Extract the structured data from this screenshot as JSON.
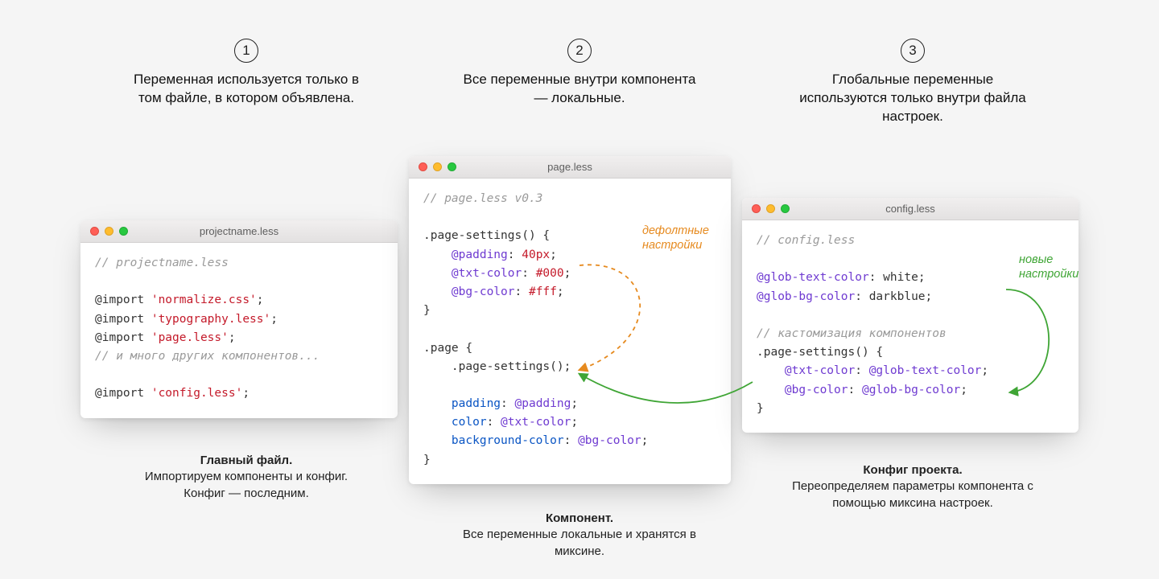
{
  "steps": [
    {
      "num": "1",
      "text": "Переменная используется только в том файле, в котором объявлена."
    },
    {
      "num": "2",
      "text": "Все переменные внутри компонента — локальные."
    },
    {
      "num": "3",
      "text": "Глобальные переменные используются только внутри файла настроек."
    }
  ],
  "windows": {
    "project": {
      "title": "projectname.less",
      "code": {
        "comment1": "// projectname.less",
        "imp": "@import",
        "s1": "'normalize.css'",
        "s2": "'typography.less'",
        "s3": "'page.less'",
        "comment2": "// и много других компонентов...",
        "s4": "'config.less'"
      }
    },
    "page": {
      "title": "page.less",
      "code": {
        "comment1": "// page.less v0.3",
        "sel_settings": ".page-settings()",
        "var_padding": "@padding",
        "val_padding": "40px",
        "var_txt": "@txt-color",
        "val_txt": "#000",
        "var_bg": "@bg-color",
        "val_bg": "#fff",
        "sel_page": ".page",
        "call_settings": ".page-settings()",
        "prop_padding": "padding",
        "prop_color": "color",
        "prop_bgcolor": "background-color"
      }
    },
    "config": {
      "title": "config.less",
      "code": {
        "comment1": "// config.less",
        "var_gtxt": "@glob-text-color",
        "val_gtxt": "white",
        "var_gbg": "@glob-bg-color",
        "val_gbg": "darkblue",
        "comment2": "// кастомизация компонентов",
        "sel_settings": ".page-settings()",
        "var_txt": "@txt-color",
        "ref_gtxt": "@glob-text-color",
        "var_bg": "@bg-color",
        "ref_gbg": "@glob-bg-color"
      }
    }
  },
  "annotations": {
    "default_settings": "дефолтные\nнастройки",
    "new_settings": "новые\nнастройки"
  },
  "footers": {
    "project": {
      "title": "Главный файл.",
      "text": "Импортируем компоненты и конфиг. Конфиг — последним."
    },
    "page": {
      "title": "Компонент.",
      "text": "Все переменные локальные и хранятся в миксине."
    },
    "config": {
      "title": "Конфиг проекта.",
      "text": "Переопределяем параметры компонента с помощью миксина настроек."
    }
  }
}
